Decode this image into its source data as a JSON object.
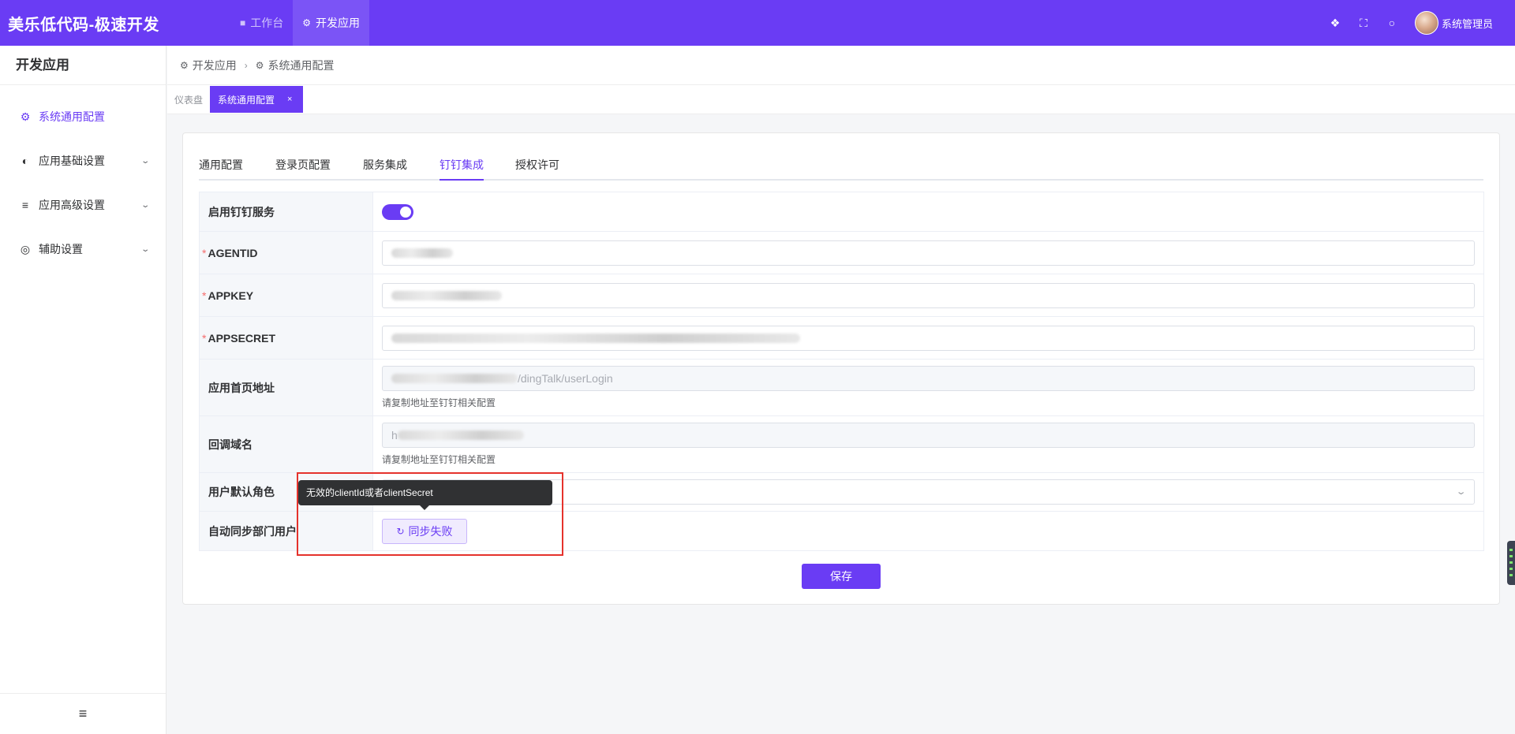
{
  "app": {
    "title": "美乐低代码-极速开发"
  },
  "top_nav": [
    {
      "label": "工作台",
      "icon": "monitor-icon"
    },
    {
      "label": "开发应用",
      "icon": "gear-icon"
    }
  ],
  "header": {
    "icons": [
      "translate-icon",
      "fullscreen-icon",
      "message-icon"
    ],
    "user_name": "系统管理员"
  },
  "sidebar": {
    "title": "开发应用",
    "items": [
      {
        "label": "系统通用配置",
        "icon": "gear-icon"
      },
      {
        "label": "应用基础设置",
        "icon": "compass-icon"
      },
      {
        "label": "应用高级设置",
        "icon": "sliders-icon"
      },
      {
        "label": "辅助设置",
        "icon": "lifebuoy-icon"
      }
    ],
    "collapse_icon": "≡"
  },
  "breadcrumb": [
    "开发应用",
    "系统通用配置"
  ],
  "tags": {
    "dashboard": "仪表盘",
    "active": "系统通用配置",
    "close": "×"
  },
  "tabs": [
    "通用配置",
    "登录页配置",
    "服务集成",
    "钉钉集成",
    "授权许可"
  ],
  "form": {
    "enable_label": "启用钉钉服务",
    "enable_value": true,
    "agentid_label": "AGENTID",
    "appkey_label": "APPKEY",
    "appsecret_label": "APPSECRET",
    "home_url_label": "应用首页地址",
    "home_url_suffix": "/dingTalk/userLogin",
    "home_url_hint": "请复制地址至钉钉相关配置",
    "callback_label": "回调域名",
    "callback_prefix": "h",
    "callback_hint": "请复制地址至钉钉相关配置",
    "default_role_label": "用户默认角色",
    "auto_sync_label": "自动同步部门用户",
    "sync_button": "同步失败"
  },
  "tooltip": "无效的clientId或者clientSecret",
  "save_button": "保存",
  "colors": {
    "primary": "#6a3cf4",
    "required": "#f56c6c",
    "highlight": "#e5322c"
  }
}
